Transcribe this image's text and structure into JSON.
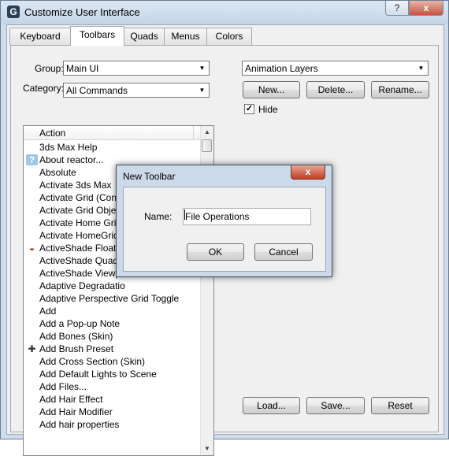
{
  "window": {
    "title": "Customize User Interface",
    "app_icon_glyph": "G",
    "help_label": "?",
    "close_label": "x"
  },
  "tabs": [
    {
      "label": "Keyboard",
      "active": false
    },
    {
      "label": "Toolbars",
      "active": true
    },
    {
      "label": "Quads",
      "active": false
    },
    {
      "label": "Menus",
      "active": false
    },
    {
      "label": "Colors",
      "active": false
    }
  ],
  "left": {
    "group_label": "Group:",
    "group_value": "Main UI",
    "category_label": "Category:",
    "category_value": "All Commands",
    "list_header": "Action",
    "actions": [
      {
        "label": "3ds Max Help",
        "icon": ""
      },
      {
        "label": "About reactor...",
        "icon": "help-icon"
      },
      {
        "label": "Absolute",
        "icon": ""
      },
      {
        "label": "Activate 3ds Max",
        "icon": ""
      },
      {
        "label": "Activate Grid (Contex",
        "icon": ""
      },
      {
        "label": "Activate Grid Object",
        "icon": ""
      },
      {
        "label": "Activate Home Grid",
        "icon": ""
      },
      {
        "label": "Activate HomeGrid (C",
        "icon": ""
      },
      {
        "label": "ActiveShade Floater",
        "icon": "activeshade-icon"
      },
      {
        "label": "ActiveShade Quad",
        "icon": ""
      },
      {
        "label": "ActiveShade Viewpo",
        "icon": ""
      },
      {
        "label": "Adaptive Degradatio",
        "icon": ""
      },
      {
        "label": "Adaptive Perspective Grid Toggle",
        "icon": ""
      },
      {
        "label": "Add",
        "icon": ""
      },
      {
        "label": "Add a Pop-up Note",
        "icon": ""
      },
      {
        "label": "Add Bones (Skin)",
        "icon": ""
      },
      {
        "label": "Add Brush Preset",
        "icon": "plus-icon"
      },
      {
        "label": "Add Cross Section (Skin)",
        "icon": ""
      },
      {
        "label": "Add Default Lights to Scene",
        "icon": ""
      },
      {
        "label": "Add Files...",
        "icon": ""
      },
      {
        "label": "Add Hair Effect",
        "icon": ""
      },
      {
        "label": "Add Hair Modifier",
        "icon": ""
      },
      {
        "label": "Add hair properties",
        "icon": ""
      }
    ]
  },
  "right": {
    "toolbar_value": "Animation Layers",
    "new_label": "New...",
    "delete_label": "Delete...",
    "rename_label": "Rename...",
    "hide_label": "Hide",
    "hide_checked": "✓",
    "load_label": "Load...",
    "save_label": "Save...",
    "reset_label": "Reset"
  },
  "dialog": {
    "title": "New Toolbar",
    "close_label": "x",
    "name_label": "Name:",
    "name_value": "File Operations",
    "ok_label": "OK",
    "cancel_label": "Cancel"
  },
  "colors": {
    "window_frame": "#cfdceb",
    "dialog_close": "#c33d22"
  }
}
